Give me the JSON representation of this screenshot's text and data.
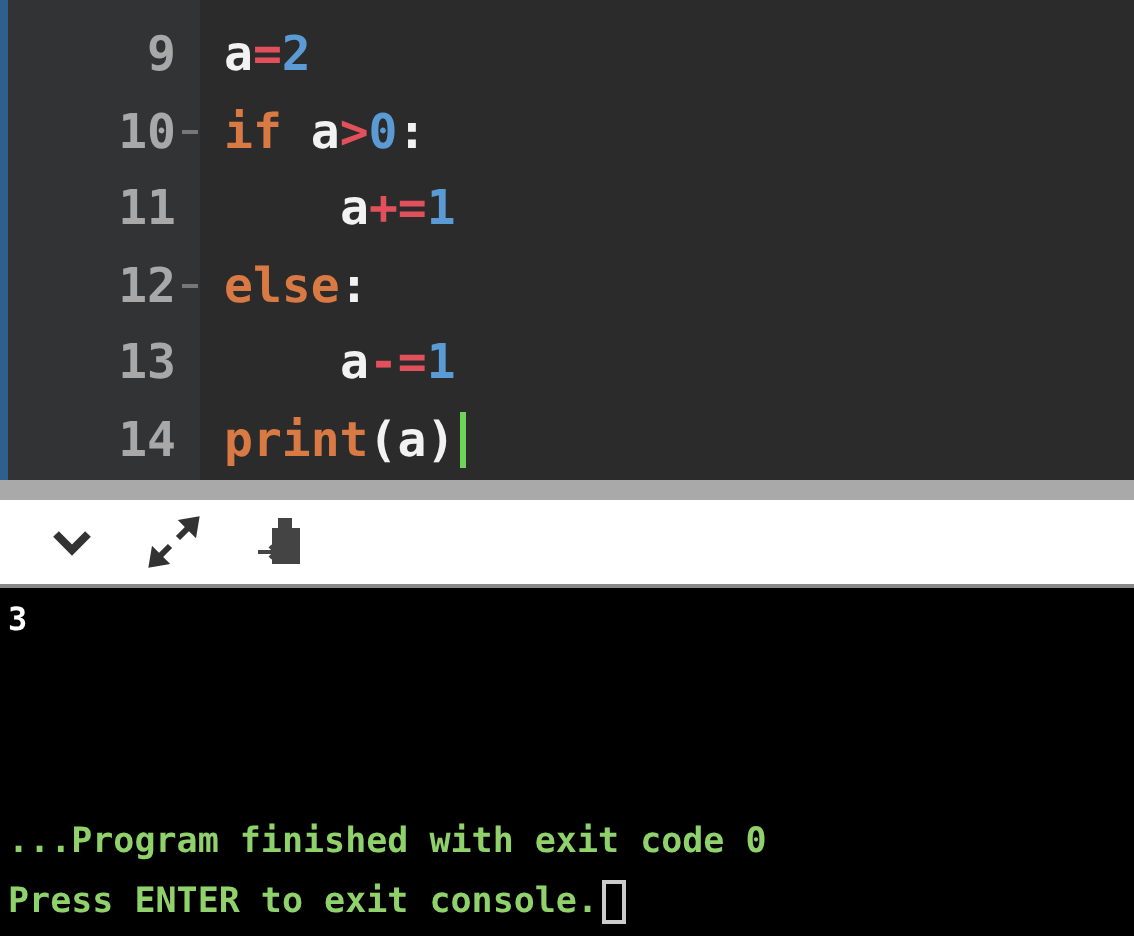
{
  "editor": {
    "lines": [
      {
        "number": "9",
        "foldable": false,
        "indented": false,
        "cursor": false,
        "tokens": [
          {
            "kind": "name",
            "text": "a"
          },
          {
            "kind": "op",
            "text": "="
          },
          {
            "kind": "num",
            "text": "2"
          }
        ]
      },
      {
        "number": "10",
        "foldable": true,
        "indented": false,
        "cursor": false,
        "tokens": [
          {
            "kind": "keyword",
            "text": "if "
          },
          {
            "kind": "name",
            "text": "a"
          },
          {
            "kind": "op",
            "text": ">"
          },
          {
            "kind": "num",
            "text": "0"
          },
          {
            "kind": "name",
            "text": ":"
          }
        ]
      },
      {
        "number": "11",
        "foldable": false,
        "indented": true,
        "cursor": false,
        "tokens": [
          {
            "kind": "name",
            "text": "a"
          },
          {
            "kind": "op",
            "text": "+="
          },
          {
            "kind": "num",
            "text": "1"
          }
        ]
      },
      {
        "number": "12",
        "foldable": true,
        "indented": false,
        "cursor": false,
        "tokens": [
          {
            "kind": "keyword",
            "text": "else"
          },
          {
            "kind": "name",
            "text": ":"
          }
        ]
      },
      {
        "number": "13",
        "foldable": false,
        "indented": true,
        "cursor": false,
        "tokens": [
          {
            "kind": "name",
            "text": "a"
          },
          {
            "kind": "op",
            "text": "-="
          },
          {
            "kind": "num",
            "text": "1"
          }
        ]
      },
      {
        "number": "14",
        "foldable": false,
        "indented": false,
        "cursor": true,
        "tokens": [
          {
            "kind": "keyword",
            "text": "print"
          },
          {
            "kind": "name",
            "text": "(a)"
          }
        ]
      }
    ]
  },
  "console": {
    "output": "3",
    "messages": [
      "...Program finished with exit code 0",
      "Press ENTER to exit console."
    ],
    "cursor": true
  }
}
